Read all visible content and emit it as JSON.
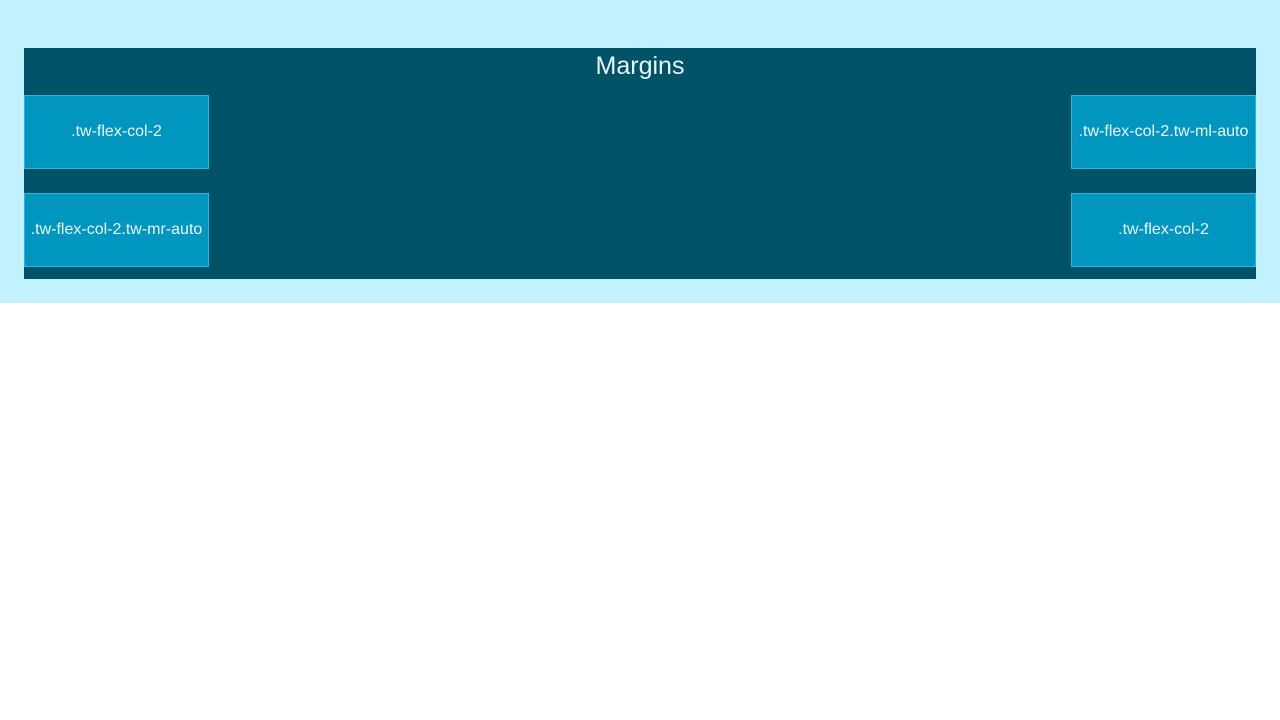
{
  "panel": {
    "title": "Margins",
    "cells": [
      {
        "label": ".tw-flex-col-2"
      },
      {
        "label": ".tw-flex-col-2.tw-ml-auto"
      },
      {
        "label": ".tw-flex-col-2.tw-mr-auto"
      },
      {
        "label": ".tw-flex-col-2"
      }
    ]
  },
  "colors": {
    "outer_background": "#c2f1ff",
    "panel_background": "#005267",
    "cell_background": "#0096bf",
    "cell_border": "#29b6e0"
  }
}
